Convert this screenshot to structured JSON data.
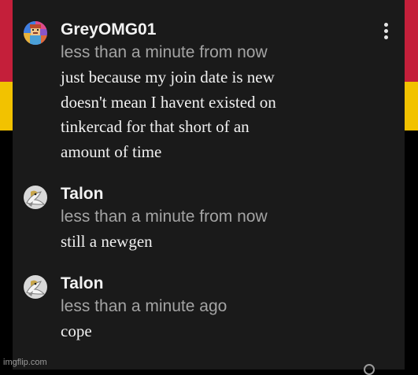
{
  "comments": [
    {
      "username": "GreyOMG01",
      "timestamp": "less than a minute from now",
      "lines": [
        "just because my join date is new",
        "doesn't mean I havent existed on",
        "tinkercad for that short of an",
        "amount of time"
      ],
      "avatar_icon": "pixel-avatar-icon"
    },
    {
      "username": "Talon",
      "timestamp": "less than a minute from now",
      "lines": [
        "still a newgen"
      ],
      "avatar_icon": "bird-avatar-icon"
    },
    {
      "username": "Talon",
      "timestamp": "less than a minute ago",
      "lines": [
        "cope"
      ],
      "avatar_icon": "bird-avatar-icon"
    }
  ],
  "more_menu_icon": "vertical-ellipsis-icon",
  "watermark": "imgflip.com",
  "colors": {
    "background": "#000000",
    "panel": "#1a1a1a",
    "username": "#f2f2f2",
    "timestamp": "#a4a4a4",
    "message": "#f0f0f0",
    "edge_red": "#c41f3a",
    "edge_yellow": "#f2c200"
  }
}
